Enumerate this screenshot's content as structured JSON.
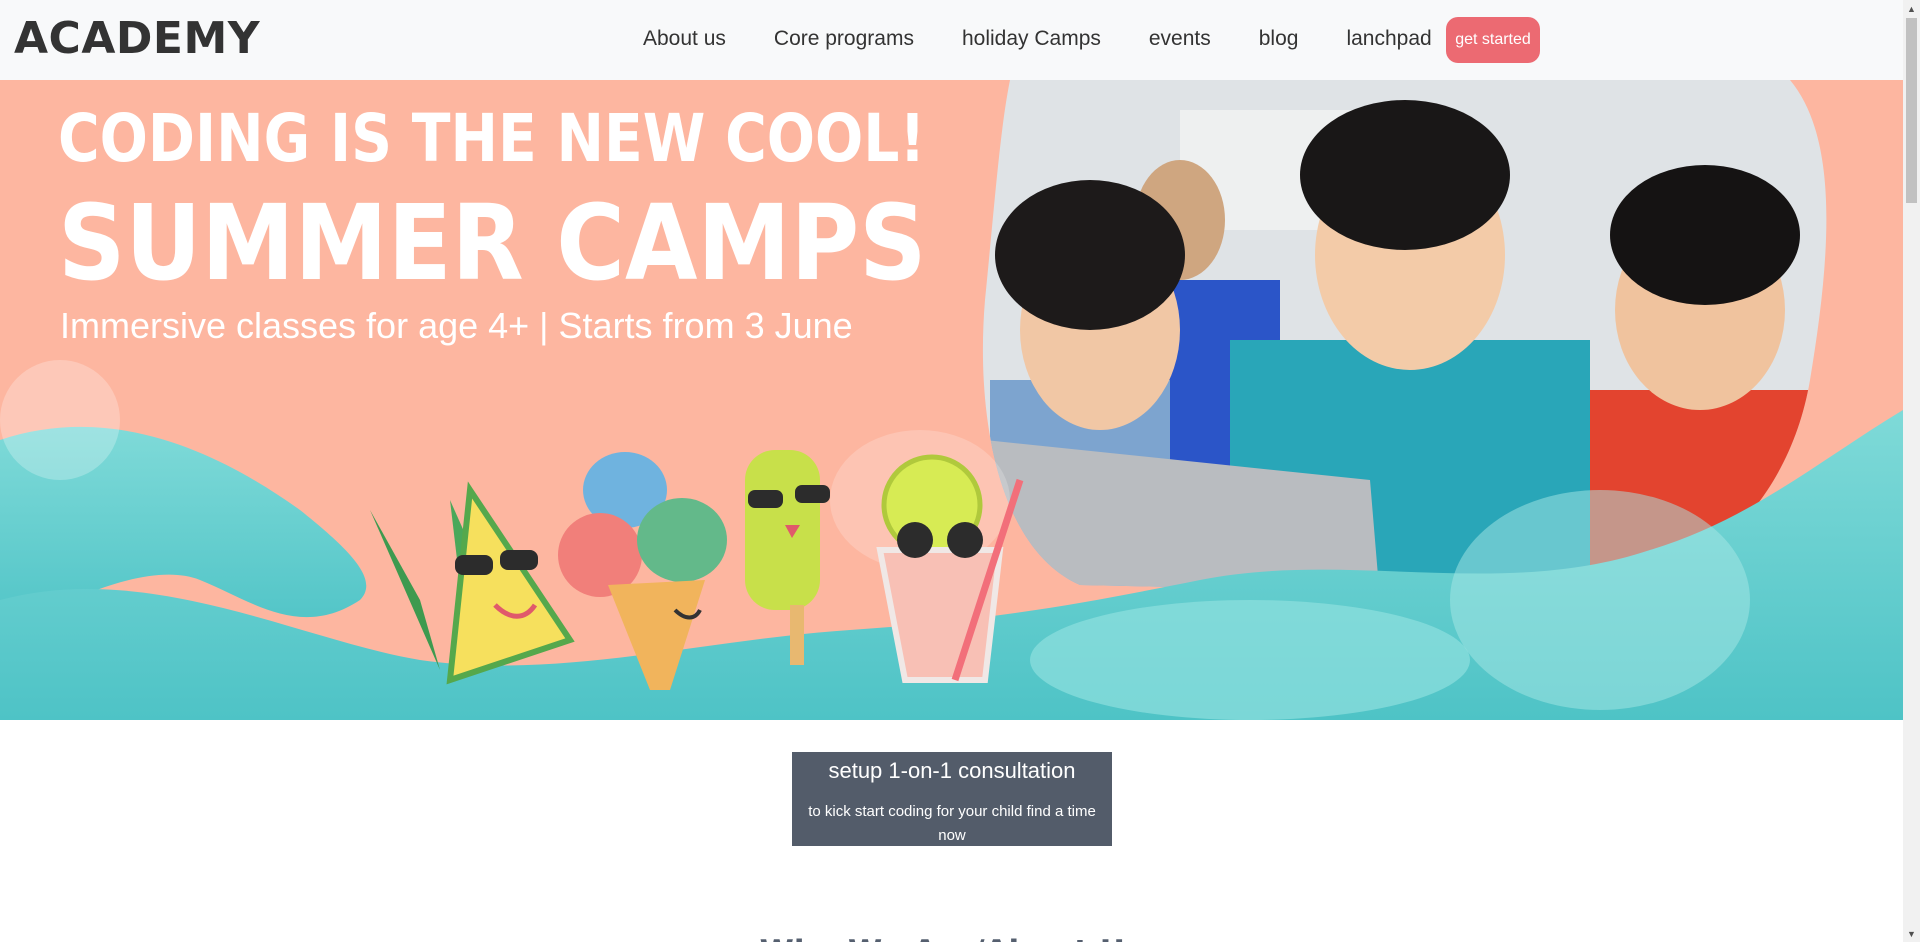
{
  "navbar": {
    "brand": "ACADEMY",
    "links": [
      "About us",
      "Core programs",
      "holiday Camps",
      "events",
      "blog",
      "lanchpad"
    ],
    "cta_label": "get started"
  },
  "hero": {
    "title_line1": "CODING IS THE NEW COOL!",
    "title_line2": "SUMMER CAMPS",
    "subtitle": "Immersive classes for age 4+ | Starts from 3 June",
    "colors": {
      "peach": "#fdb6a0",
      "teal": "#5ccbcb"
    },
    "illustrations": [
      "pineapple-icon",
      "ice-cream-icon",
      "popsicle-icon",
      "lemonade-icon"
    ],
    "photo_subject": "kids-coding-photo"
  },
  "consultation": {
    "title": "setup 1-on-1 consultation",
    "text": "to kick start coding for your child find a time now"
  },
  "section": {
    "title": "Who We Are/About Us"
  },
  "colors": {
    "accent": "#ec6a72",
    "consult_bg": "#535c6a"
  }
}
